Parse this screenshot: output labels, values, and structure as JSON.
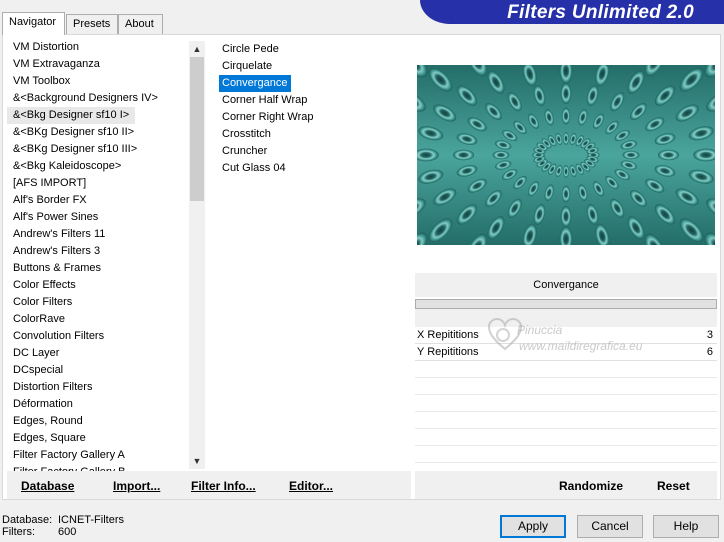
{
  "tabs": [
    {
      "label": "Navigator"
    },
    {
      "label": "Presets"
    },
    {
      "label": "About"
    }
  ],
  "banner": {
    "title": "Filters Unlimited 2.0"
  },
  "categories": [
    "VM Distortion",
    "VM Extravaganza",
    "VM Toolbox",
    "&<Background Designers IV>",
    "&<Bkg Designer sf10 I>",
    "&<BKg Designer sf10 II>",
    "&<BKg Designer sf10 III>",
    "&<Bkg Kaleidoscope>",
    "[AFS IMPORT]",
    "Alf's Border FX",
    "Alf's Power Sines",
    "Andrew's Filters 11",
    "Andrew's Filters 3",
    "Buttons & Frames",
    "Color Effects",
    "Color Filters",
    "ColorRave",
    "Convolution Filters",
    "DC Layer",
    "DCspecial",
    "Distortion Filters",
    "Déformation",
    "Edges, Round",
    "Edges, Square",
    "Filter Factory Gallery A",
    "Filter Factory Gallery B"
  ],
  "selected_category_index": 4,
  "filters": [
    "Circle Pede",
    "Cirquelate",
    "Convergance",
    "Corner Half Wrap",
    "Corner Right Wrap",
    "Crosstitch",
    "Cruncher",
    "Cut Glass 04"
  ],
  "selected_filter_index": 2,
  "current_filter": "Convergance",
  "params": [
    {
      "label": "X Repititions",
      "value": "3"
    },
    {
      "label": "Y Repititions",
      "value": "6"
    }
  ],
  "watermark": {
    "line1": "Pinuccia",
    "line2": "www.maildiregrafica.eu"
  },
  "bottom_links": {
    "database": "Database",
    "import": "Import...",
    "filter_info": "Filter Info...",
    "editor": "Editor...",
    "randomize": "Randomize",
    "reset": "Reset"
  },
  "status": {
    "database_label": "Database:",
    "database_value": "ICNET-Filters",
    "filters_label": "Filters:",
    "filters_value": "600"
  },
  "buttons": {
    "apply": "Apply",
    "cancel": "Cancel",
    "help": "Help"
  },
  "colors": {
    "banner": "#2630a8",
    "selection": "#0078d7",
    "preview_base": "#3a8a84"
  }
}
